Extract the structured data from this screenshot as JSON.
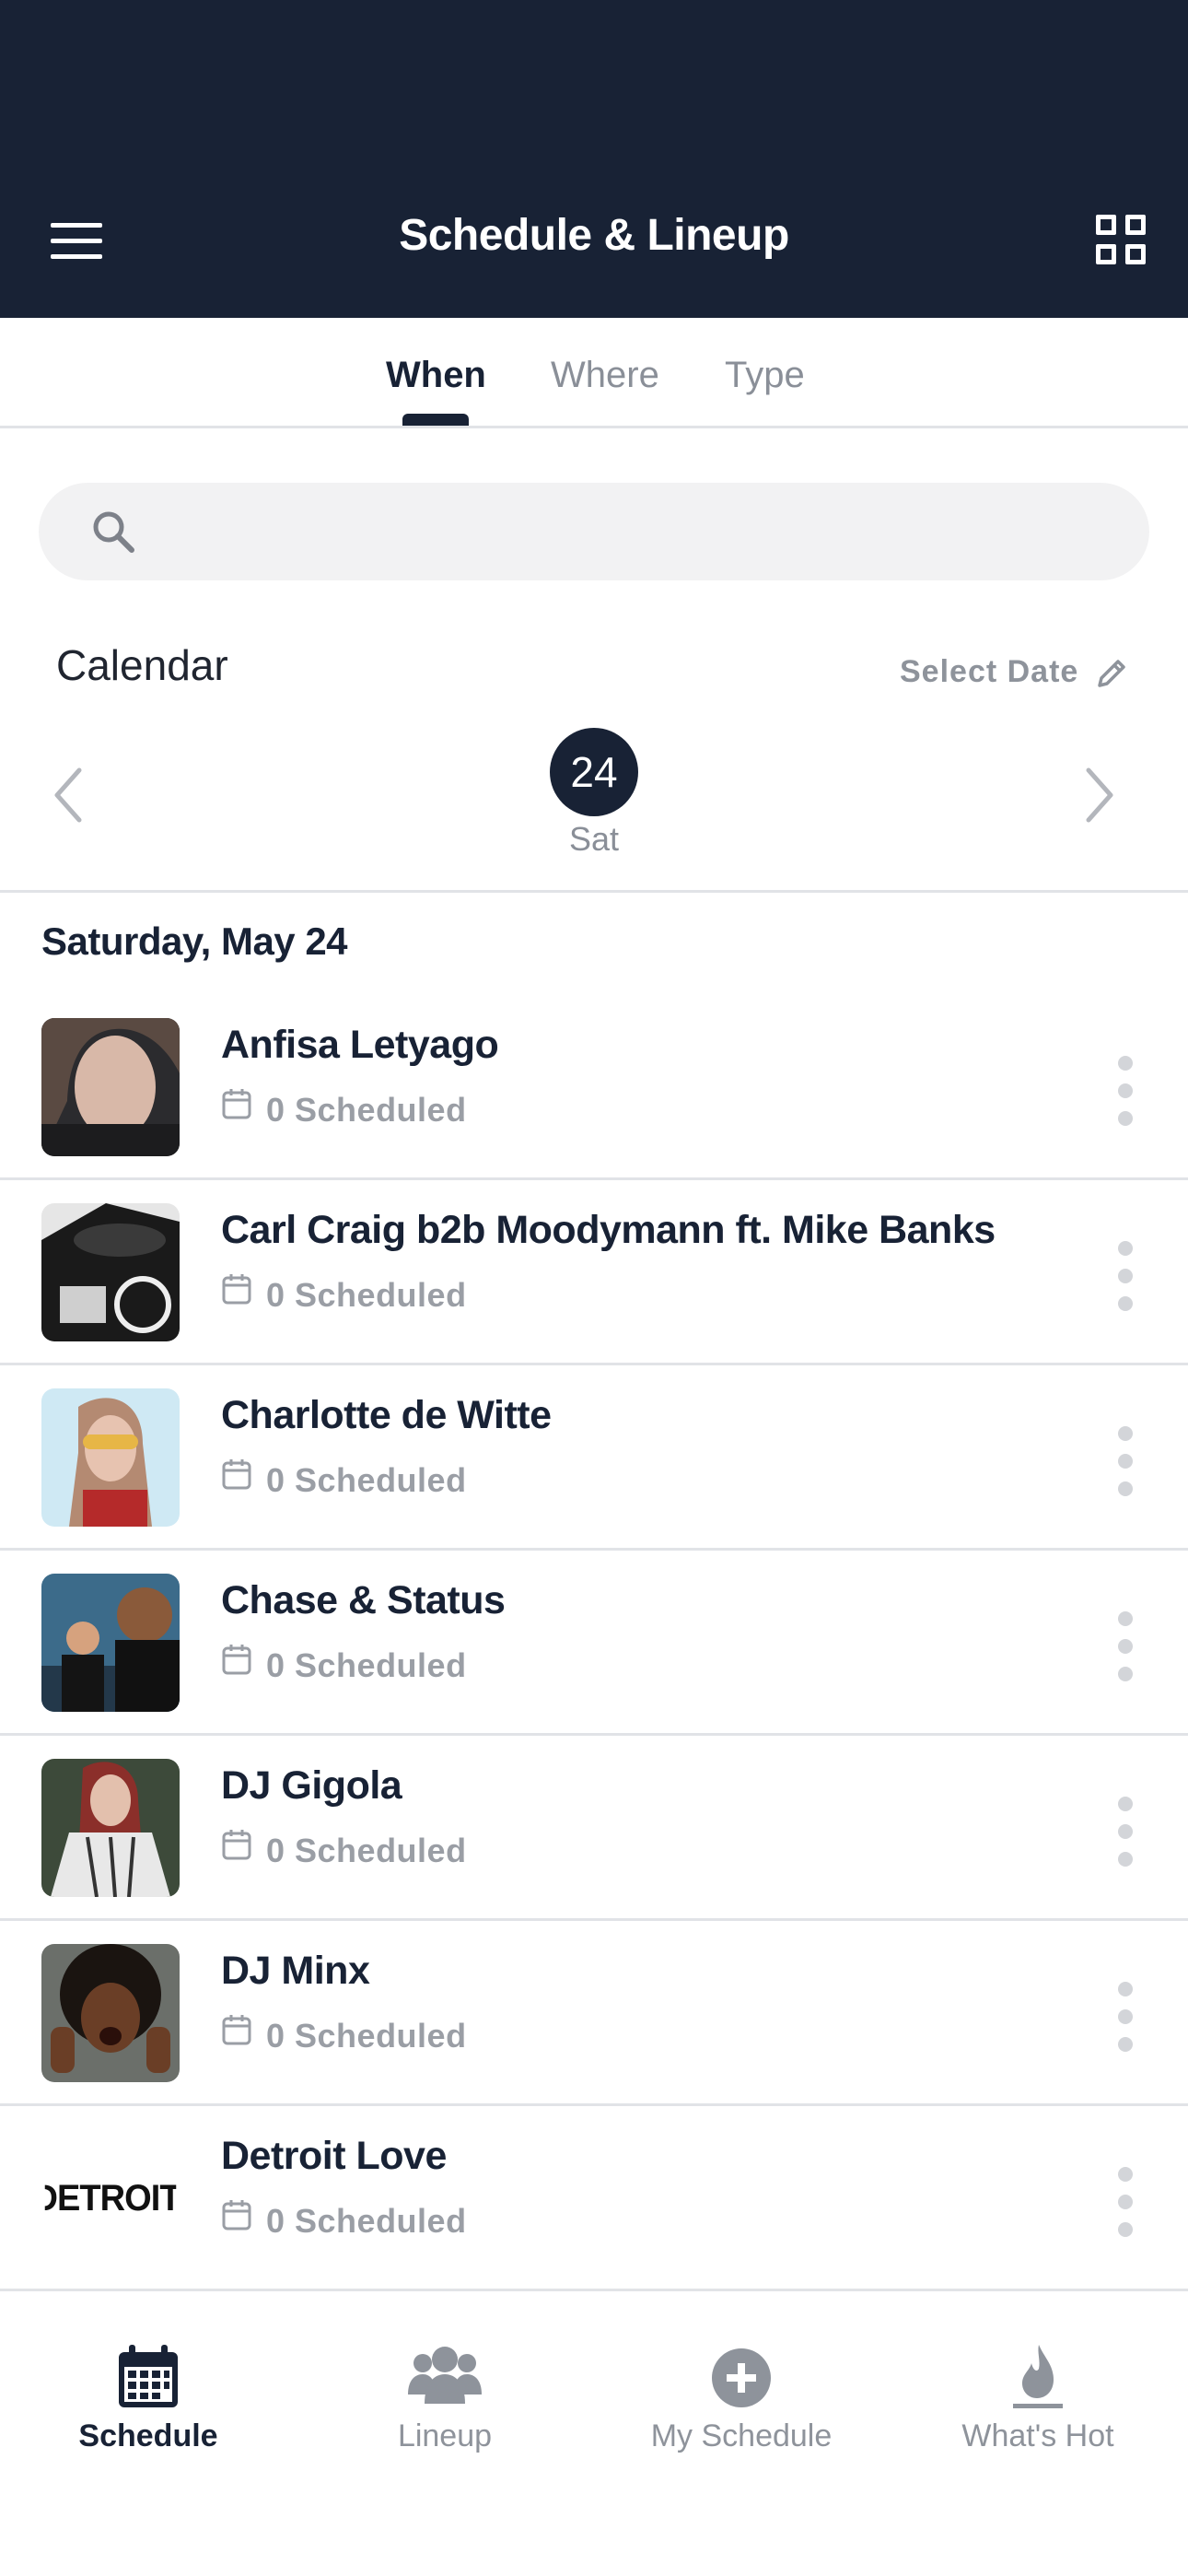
{
  "header": {
    "title": "Schedule & Lineup"
  },
  "tabs": [
    {
      "label": "When",
      "active": true
    },
    {
      "label": "Where",
      "active": false
    },
    {
      "label": "Type",
      "active": false
    }
  ],
  "search": {
    "placeholder": "",
    "value": ""
  },
  "calendar": {
    "label": "Calendar",
    "select_date": "Select Date",
    "selected_day": "24",
    "selected_dow": "Sat"
  },
  "day_heading": "Saturday, May 24",
  "artists": [
    {
      "name": "Anfisa Letyago",
      "scheduled": "0 Scheduled"
    },
    {
      "name": "Carl Craig b2b Moodymann ft. Mike Banks",
      "scheduled": "0 Scheduled"
    },
    {
      "name": "Charlotte de Witte",
      "scheduled": "0 Scheduled"
    },
    {
      "name": "Chase & Status",
      "scheduled": "0 Scheduled"
    },
    {
      "name": "DJ Gigola",
      "scheduled": "0 Scheduled"
    },
    {
      "name": "DJ Minx",
      "scheduled": "0 Scheduled"
    },
    {
      "name": "Detroit Love",
      "scheduled": "0 Scheduled",
      "logo_text": "DETROIT"
    }
  ],
  "bottom_nav": [
    {
      "label": "Schedule",
      "icon": "calendar-icon",
      "active": true
    },
    {
      "label": "Lineup",
      "icon": "people-icon",
      "active": false
    },
    {
      "label": "My Schedule",
      "icon": "plus-circle-icon",
      "active": false
    },
    {
      "label": "What's Hot",
      "icon": "flame-icon",
      "active": false
    }
  ],
  "colors": {
    "header_bg": "#182235",
    "accent": "#182235",
    "muted_text": "#8e939b",
    "divider": "#e1e3e7"
  }
}
